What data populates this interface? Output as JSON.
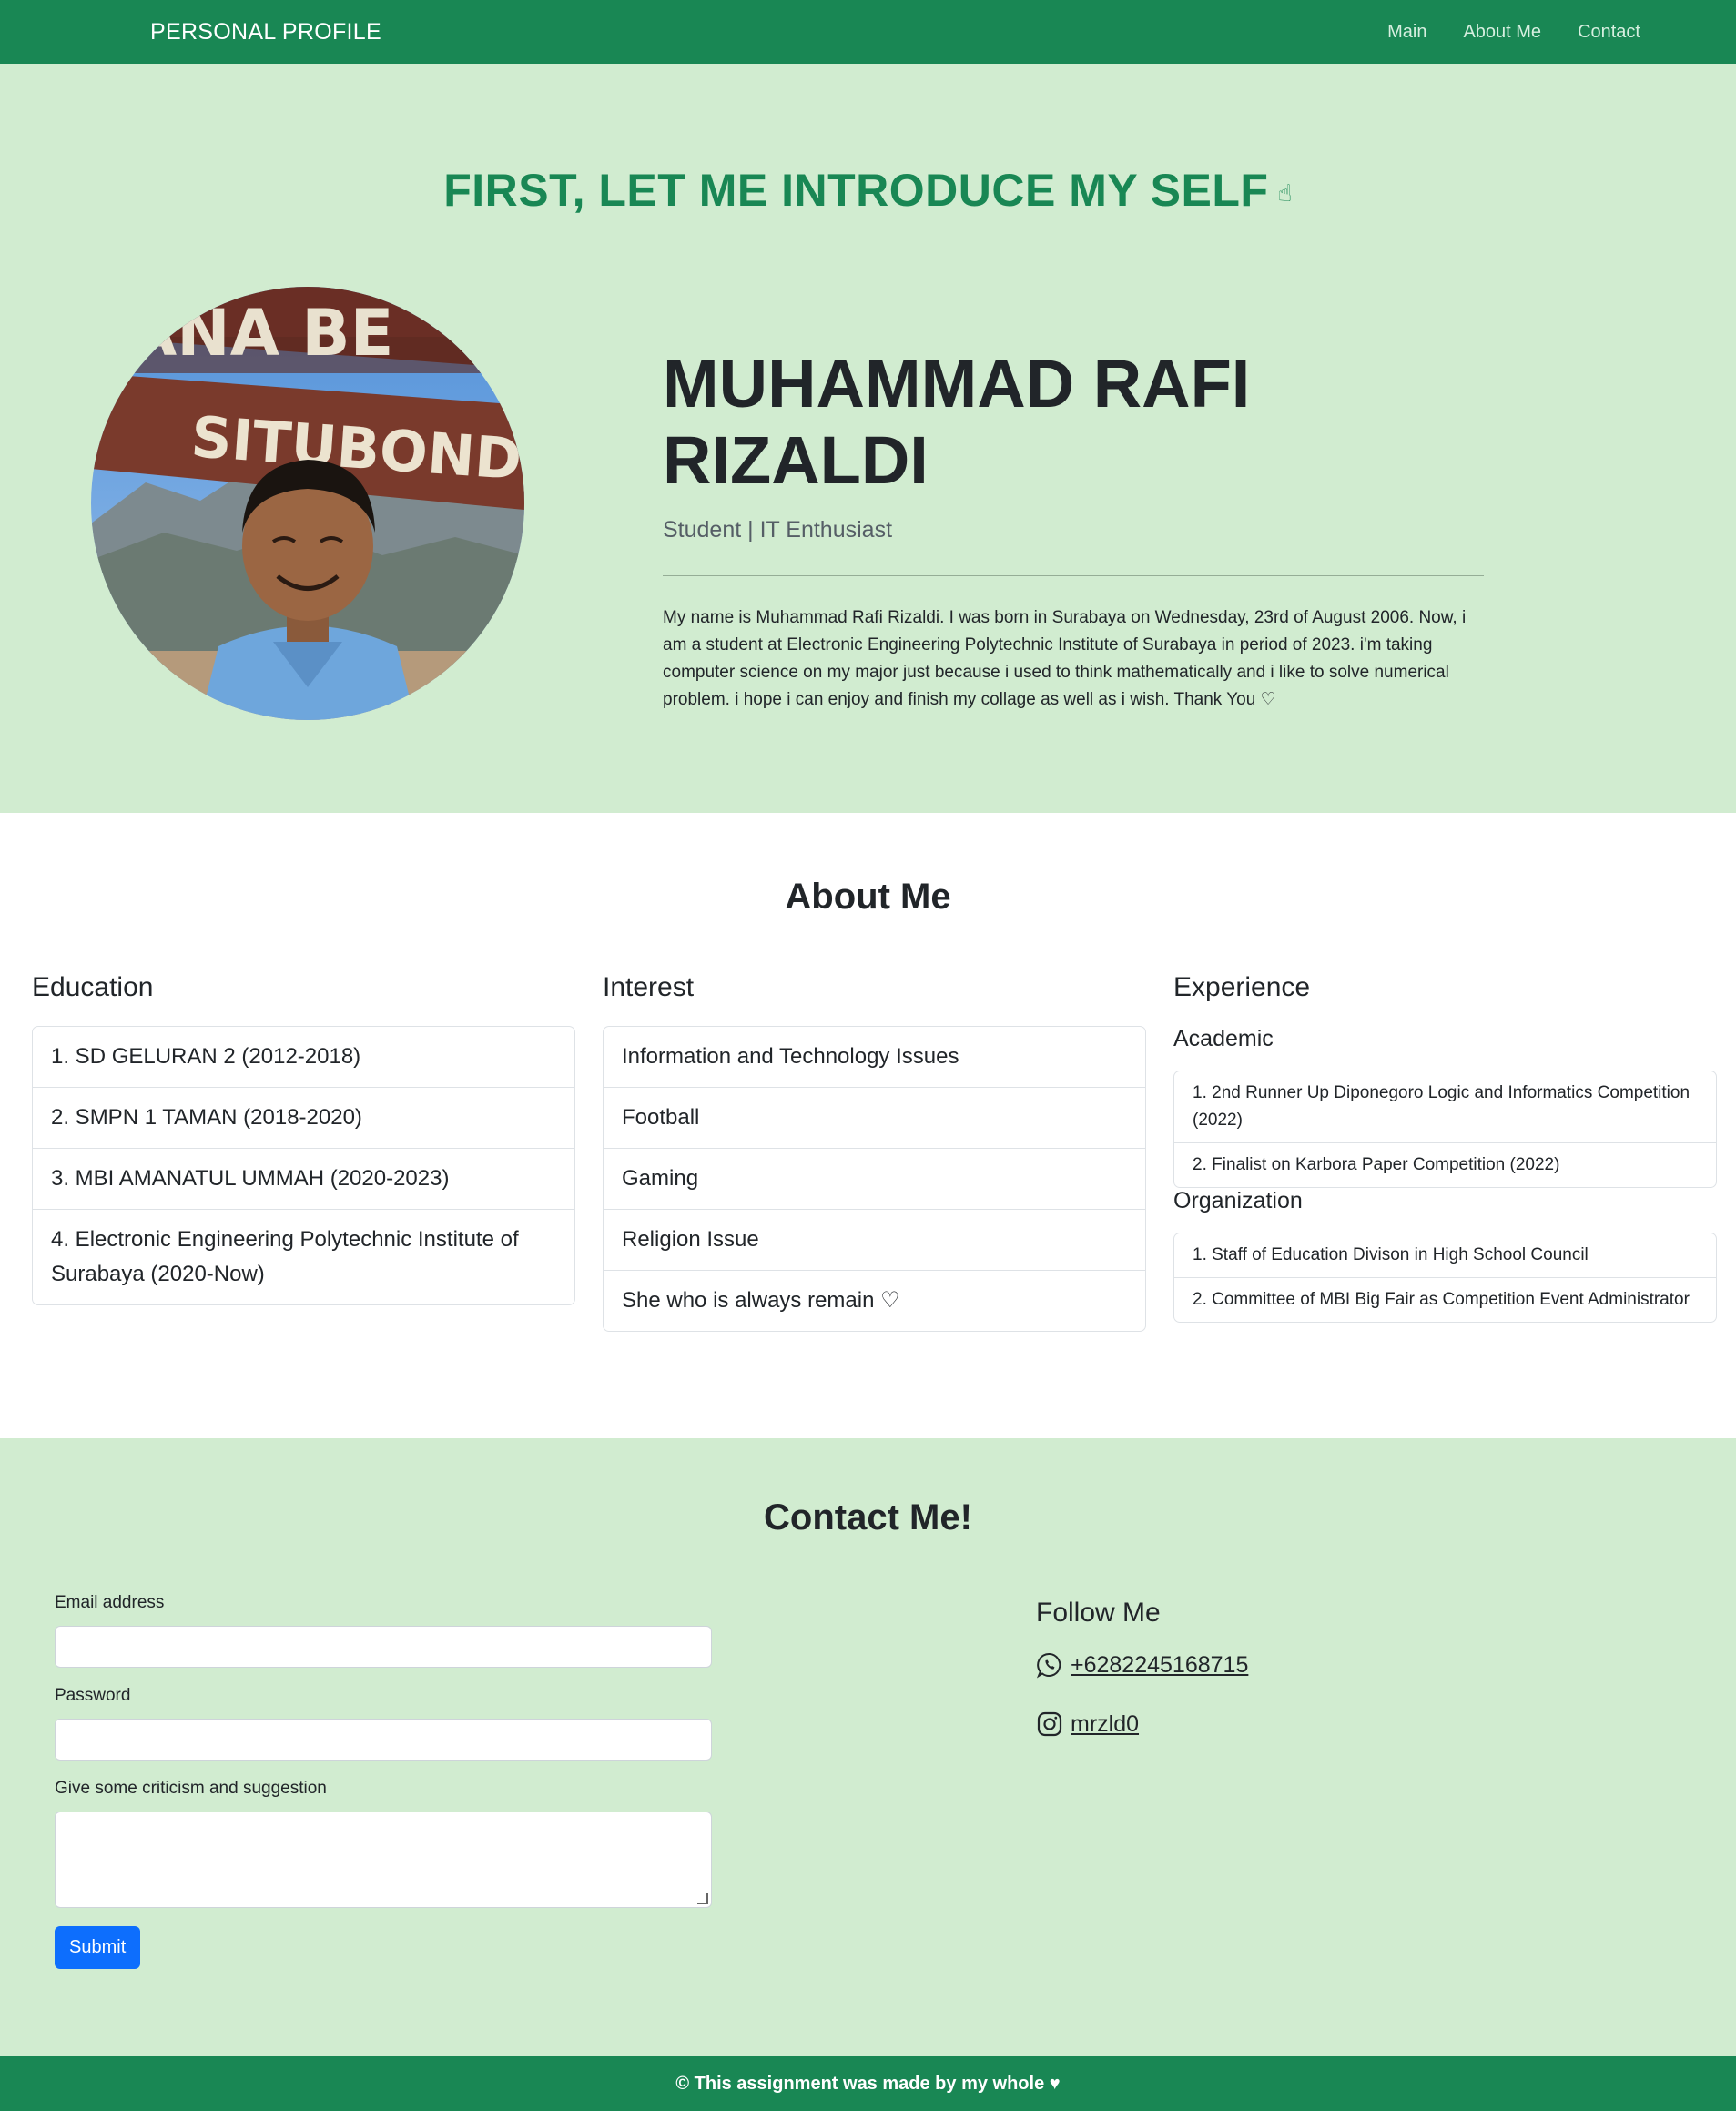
{
  "navbar": {
    "brand": "PERSONAL PROFILE",
    "links": [
      "Main",
      "About Me",
      "Contact"
    ]
  },
  "hero": {
    "title": "FIRST, LET ME INTRODUCE MY SELF",
    "title_icon": "hand-pointing-icon",
    "name": "MUHAMMAD RAFI RIZALDI",
    "role": "Student | IT Enthusiast",
    "bio": "My name is Muhammad Rafi Rizaldi. I was born in Surabaya on Wednesday, 23rd of August 2006. Now, i am a student at Electronic Engineering Polytechnic Institute of Surabaya in period of 2023. i'm taking computer science on my major just because i used to think mathematically and i like to solve numerical problem. i hope i can enjoy and finish my collage as well as i wish. Thank You",
    "bio_icon": "heart-outline-icon",
    "photo_sign_top": "ANA BE",
    "photo_sign_bottom": "SITUBONDO"
  },
  "about": {
    "title": "About Me",
    "education": {
      "title": "Education",
      "items": [
        "1. SD GELURAN 2 (2012-2018)",
        "2. SMPN 1 TAMAN (2018-2020)",
        "3. MBI AMANATUL UMMAH (2020-2023)",
        "4. Electronic Engineering Polytechnic Institute of Surabaya (2020-Now)"
      ]
    },
    "interest": {
      "title": "Interest",
      "items": [
        "Information and Technology Issues",
        "Football",
        "Gaming",
        "Religion Issue",
        "She who is always remain"
      ]
    },
    "experience": {
      "title": "Experience",
      "academic_title": "Academic",
      "academic": [
        "1. 2nd Runner Up Diponegoro Logic and Informatics Competition (2022)",
        "2. Finalist on Karbora Paper Competition (2022)"
      ],
      "organization_title": "Organization",
      "organization": [
        "1. Staff of Education Divison in High School Council",
        "2. Committee of MBI Big Fair as Competition Event Administrator"
      ]
    }
  },
  "contact": {
    "title": "Contact Me!",
    "email_label": "Email address",
    "password_label": "Password",
    "suggestion_label": "Give some criticism and suggestion",
    "submit_label": "Submit",
    "follow_title": "Follow Me",
    "whatsapp": " +6282245168715",
    "instagram": " mrzld0"
  },
  "footer": {
    "text": "© This assignment was made by my whole"
  },
  "colors": {
    "primary_green": "#198754",
    "light_green_bg": "#d1ecd0",
    "submit_blue": "#0d6efd"
  }
}
